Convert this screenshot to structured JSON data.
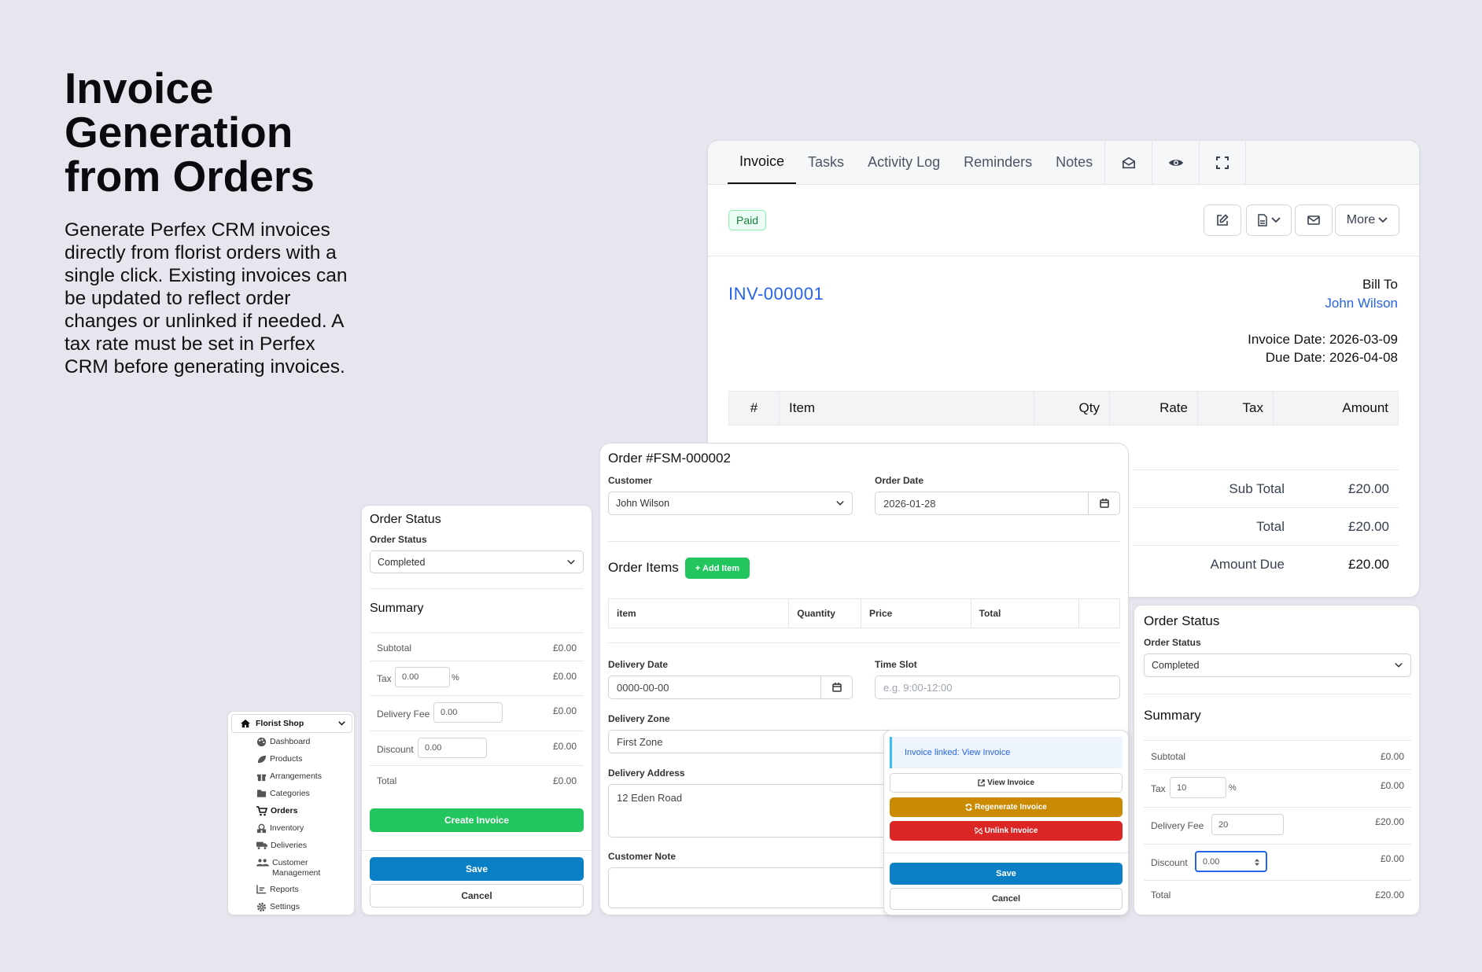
{
  "hero": {
    "title": "Invoice Generation from Orders",
    "description": "Generate Perfex CRM invoices directly from florist orders with a single click. Existing invoices can be updated to reflect order changes or unlinked if needed. A tax rate must be set in Perfex CRM before generating invoices."
  },
  "invoice": {
    "tabs": [
      "Invoice",
      "Tasks",
      "Activity Log",
      "Reminders",
      "Notes"
    ],
    "tab_icons": [
      "envelope-open-icon",
      "eye-icon",
      "expand-icon"
    ],
    "status": "Paid",
    "more_label": "More",
    "number": "INV-000001",
    "bill_to_label": "Bill To",
    "customer": "John Wilson",
    "invoice_date": "Invoice Date: 2026-03-09",
    "due_date": "Due Date: 2026-04-08",
    "columns": [
      "#",
      "Item",
      "Qty",
      "Rate",
      "Tax",
      "Amount"
    ],
    "sub_total_label": "Sub Total",
    "sub_total": "£20.00",
    "total_label": "Total",
    "total": "£20.00",
    "amount_due_label": "Amount Due",
    "amount_due": "£20.00",
    "colors": {
      "link": "#2563eb",
      "paid": "#15803d"
    }
  },
  "status_left": {
    "title": "Order Status",
    "status_label": "Order Status",
    "status_value": "Completed",
    "summary_title": "Summary",
    "subtotal_label": "Subtotal",
    "subtotal": "£0.00",
    "tax_label": "Tax",
    "tax_value": "0.00",
    "tax_unit": "%",
    "tax_amount": "£0.00",
    "delivery_fee_label": "Delivery Fee",
    "delivery_fee_value": "0.00",
    "delivery_fee_amount": "£0.00",
    "discount_label": "Discount",
    "discount_value": "0.00",
    "discount_amount": "£0.00",
    "total_label": "Total",
    "total": "£0.00",
    "create_invoice": "Create Invoice",
    "save": "Save",
    "cancel": "Cancel"
  },
  "sidebar": {
    "shop": "Florist Shop",
    "items": [
      {
        "label": "Dashboard",
        "icon": "palette-icon"
      },
      {
        "label": "Products",
        "icon": "leaf-icon"
      },
      {
        "label": "Arrangements",
        "icon": "gift-icon"
      },
      {
        "label": "Categories",
        "icon": "folder-icon"
      },
      {
        "label": "Orders",
        "icon": "cart-icon"
      },
      {
        "label": "Inventory",
        "icon": "boxes-icon"
      },
      {
        "label": "Deliveries",
        "icon": "truck-icon"
      },
      {
        "label": "Customer Management",
        "icon": "users-icon"
      },
      {
        "label": "Reports",
        "icon": "chart-icon"
      },
      {
        "label": "Settings",
        "icon": "gear-icon"
      }
    ]
  },
  "order": {
    "title": "Order #FSM-000002",
    "customer_label": "Customer",
    "customer_value": "John Wilson",
    "order_date_label": "Order Date",
    "order_date_value": "2026-01-28",
    "items_title": "Order Items",
    "add_item": "+ Add Item",
    "columns": [
      "item",
      "Quantity",
      "Price",
      "Total"
    ],
    "delivery_date_label": "Delivery Date",
    "delivery_date_value": "0000-00-00",
    "time_slot_label": "Time Slot",
    "time_slot_placeholder": "e.g. 9:00-12:00",
    "delivery_zone_label": "Delivery Zone",
    "delivery_zone_value": "First Zone",
    "delivery_address_label": "Delivery Address",
    "delivery_address_value": "12 Eden Road",
    "customer_note_label": "Customer Note"
  },
  "popup": {
    "linked_text": "Invoice linked: View Invoice",
    "view_invoice": "View Invoice",
    "regenerate": "Regenerate Invoice",
    "unlink": "Unlink Invoice",
    "save": "Save",
    "cancel": "Cancel",
    "colors": {
      "regenerate": "#ca8a04",
      "unlink": "#dc2626",
      "save": "#0a7fc6"
    }
  },
  "status_right": {
    "title": "Order Status",
    "status_label": "Order Status",
    "status_value": "Completed",
    "summary_title": "Summary",
    "subtotal_label": "Subtotal",
    "subtotal": "£0.00",
    "tax_label": "Tax",
    "tax_value": "10",
    "tax_unit": "%",
    "tax_amount": "£0.00",
    "delivery_fee_label": "Delivery Fee",
    "delivery_fee_value": "20",
    "delivery_fee_amount": "£20.00",
    "discount_label": "Discount",
    "discount_value": "0.00",
    "discount_amount": "£0.00",
    "total_label": "Total",
    "total": "£20.00"
  }
}
